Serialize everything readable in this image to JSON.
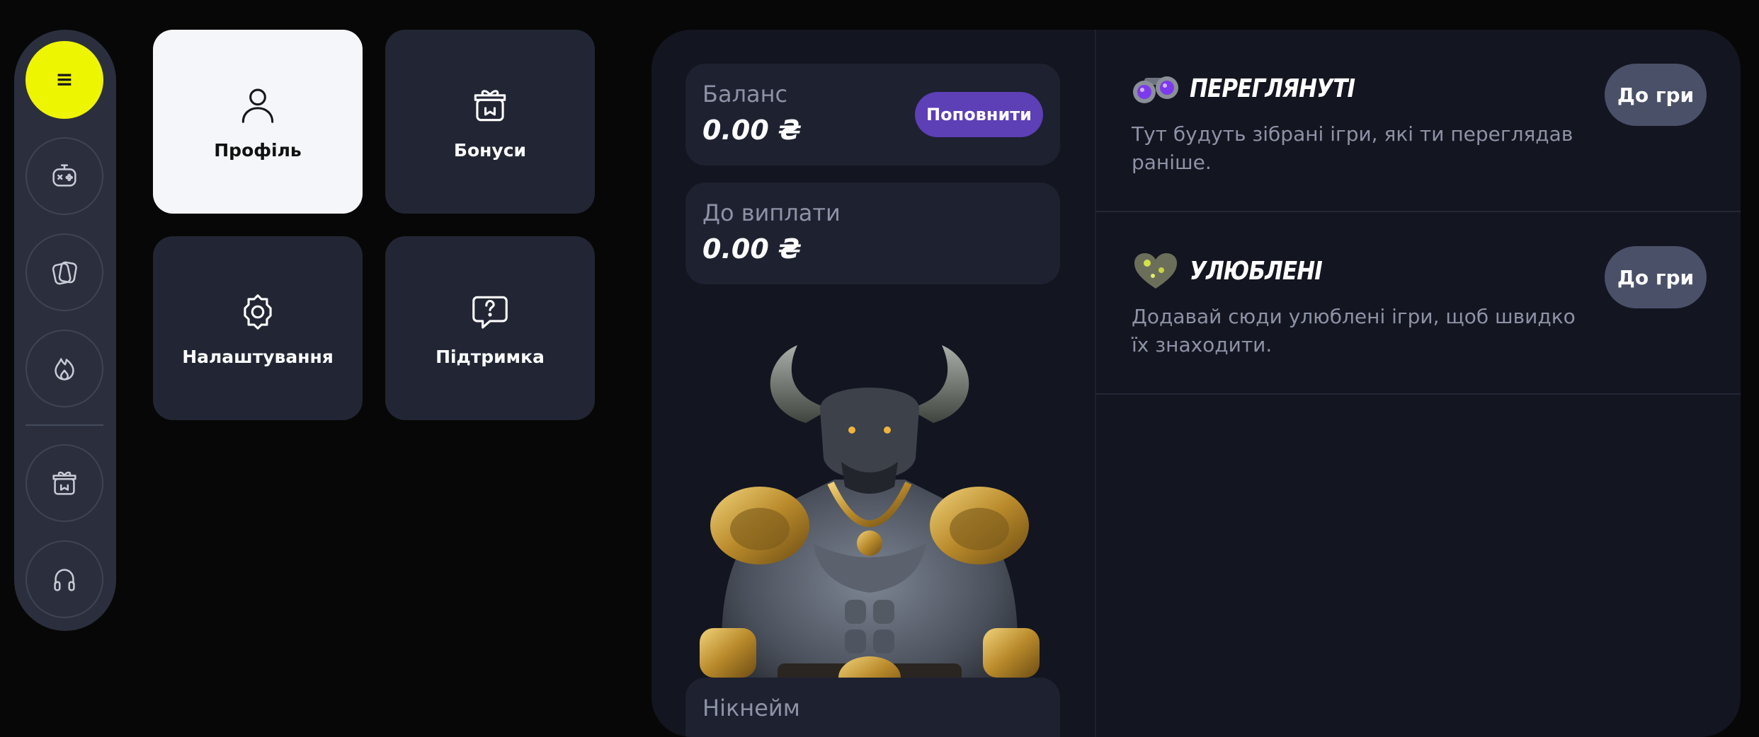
{
  "rail": {
    "menu_glyph": "≡",
    "items": [
      {
        "icon": "gamepad-icon"
      },
      {
        "icon": "cards-icon"
      },
      {
        "icon": "flame-icon"
      },
      {
        "icon": "gift-icon"
      },
      {
        "icon": "headset-icon"
      }
    ],
    "accent": "#eef500"
  },
  "tiles": [
    {
      "label": "Профіль",
      "icon": "user-icon",
      "active": true
    },
    {
      "label": "Бонуси",
      "icon": "gift-icon",
      "active": false
    },
    {
      "label": "Налаштування",
      "icon": "gear-icon",
      "active": false
    },
    {
      "label": "Підтримка",
      "icon": "help-chat-icon",
      "active": false
    }
  ],
  "balance": {
    "label": "Баланс",
    "value": "0.00 ₴",
    "topup_label": "Поповнити",
    "topup_color": "#5d3fb6"
  },
  "payout": {
    "label": "До виплати",
    "value": "0.00 ₴"
  },
  "nickname": {
    "label": "Нікнейм"
  },
  "sections": [
    {
      "icon": "binoculars-icon",
      "title": "ПЕРЕГЛЯНУТІ",
      "desc": "Тут будуть зібрані ігри, які ти переглядав раніше.",
      "button": "До гри"
    },
    {
      "icon": "heart-icon",
      "title": "УЛЮБЛЕНІ",
      "desc": "Додавай сюди улюблені ігри, щоб швидко їх знаходити.",
      "button": "До гри"
    }
  ]
}
